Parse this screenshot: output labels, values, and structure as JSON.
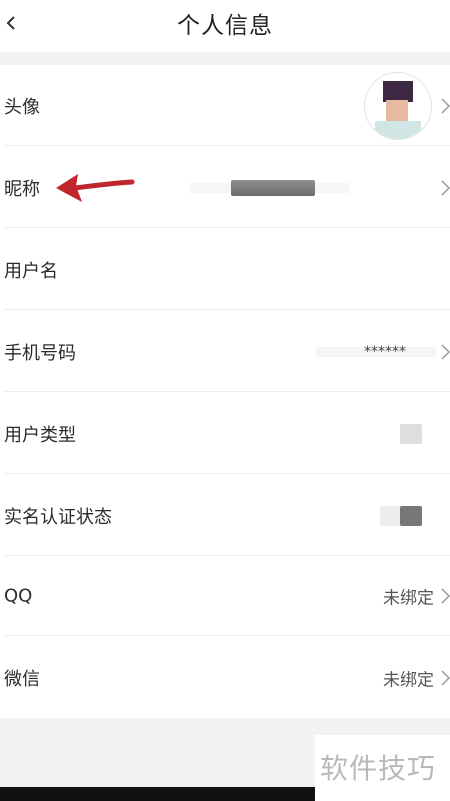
{
  "header": {
    "title": "个人信息",
    "back_icon": "chevron-left-icon"
  },
  "rows": [
    {
      "label": "头像",
      "value": "",
      "icon": "chevron-right-icon"
    },
    {
      "label": "昵称",
      "value": "",
      "icon": "chevron-right-icon"
    },
    {
      "label": "用户名",
      "value": ""
    },
    {
      "label": "手机号码",
      "value": "******",
      "icon": "chevron-right-icon"
    },
    {
      "label": "用户类型",
      "value": ""
    },
    {
      "label": "实名认证状态",
      "value": ""
    },
    {
      "label": "QQ",
      "value": "未绑定",
      "icon": "chevron-right-icon"
    },
    {
      "label": "微信",
      "value": "未绑定",
      "icon": "chevron-right-icon"
    }
  ],
  "annotation": {
    "arrow_color": "#c0262b"
  },
  "watermark": {
    "text": "软件技巧"
  }
}
